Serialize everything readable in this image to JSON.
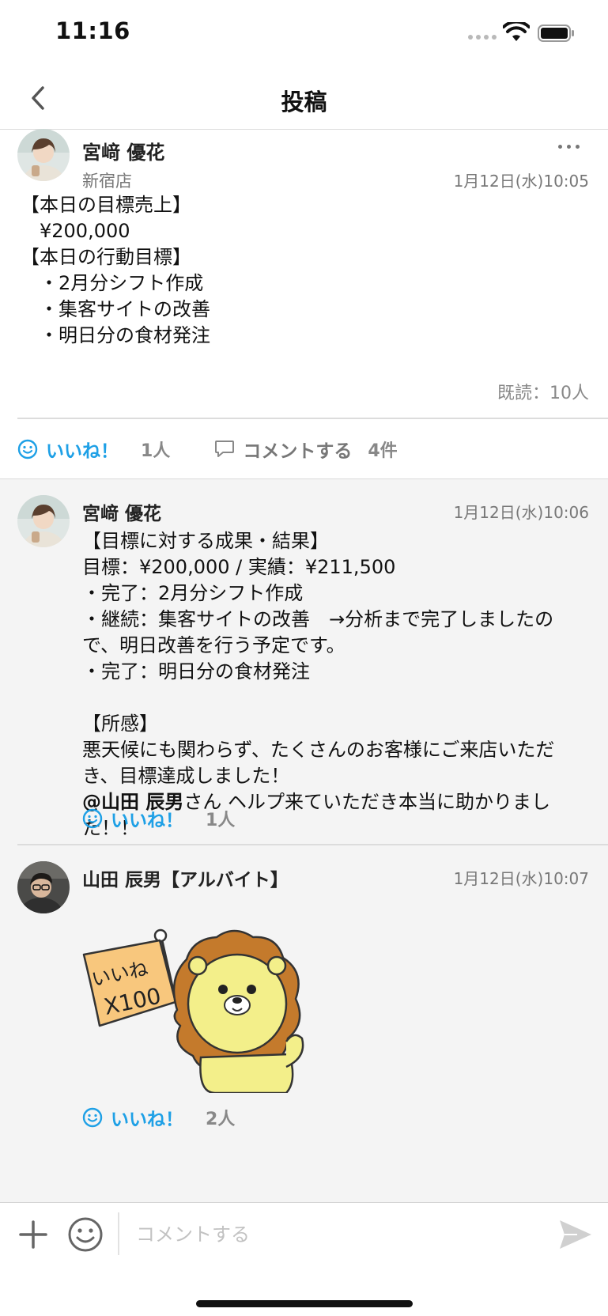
{
  "status_bar": {
    "time": "11:16"
  },
  "nav": {
    "title": "投稿"
  },
  "post": {
    "author": "宮﨑 優花",
    "store": "新宿店",
    "timestamp": "1月12日(水)10:05",
    "body": "【本日の目標売上】\n　¥200,000\n【本日の行動目標】\n　・2月分シフト作成\n　・集客サイトの改善\n　・明日分の食材発注",
    "read_count": "既読：10人",
    "like_label": "いいね！",
    "like_count": "1人",
    "comment_label": "コメントする",
    "comment_count": "4件"
  },
  "comments": [
    {
      "author": "宮﨑 優花",
      "timestamp": "1月12日(水)10:06",
      "body": "【目標に対する成果・結果】\n目標：¥200,000 / 実績：¥211,500\n・完了：2月分シフト作成\n・継続：集客サイトの改善　→分析まで完了しましたので、明日改善を行う予定です。\n・完了：明日分の食材発注\n\n【所感】\n悪天候にも関わらず、たくさんのお客様にご来店いただき、目標達成しました！",
      "mention": "@山田 辰男",
      "mention_suffix": "さん ヘルプ来ていただき本当に助かりました！！",
      "like_label": "いいね！",
      "like_count": "1人"
    },
    {
      "author": "山田 辰男【アルバイト】",
      "timestamp": "1月12日(水)10:07",
      "sticker_flag_text_1": "いいね",
      "sticker_flag_text_2": "X100",
      "like_label": "いいね！",
      "like_count": "2人"
    }
  ],
  "composer": {
    "placeholder": "コメントする"
  },
  "colors": {
    "accent": "#1ea0e6",
    "muted": "#777777",
    "comments_bg": "#f4f4f4"
  },
  "icons": [
    "back-chevron-icon",
    "more-dots-icon",
    "smile-icon",
    "speech-bubble-icon",
    "plus-icon",
    "emoji-icon",
    "send-icon"
  ]
}
